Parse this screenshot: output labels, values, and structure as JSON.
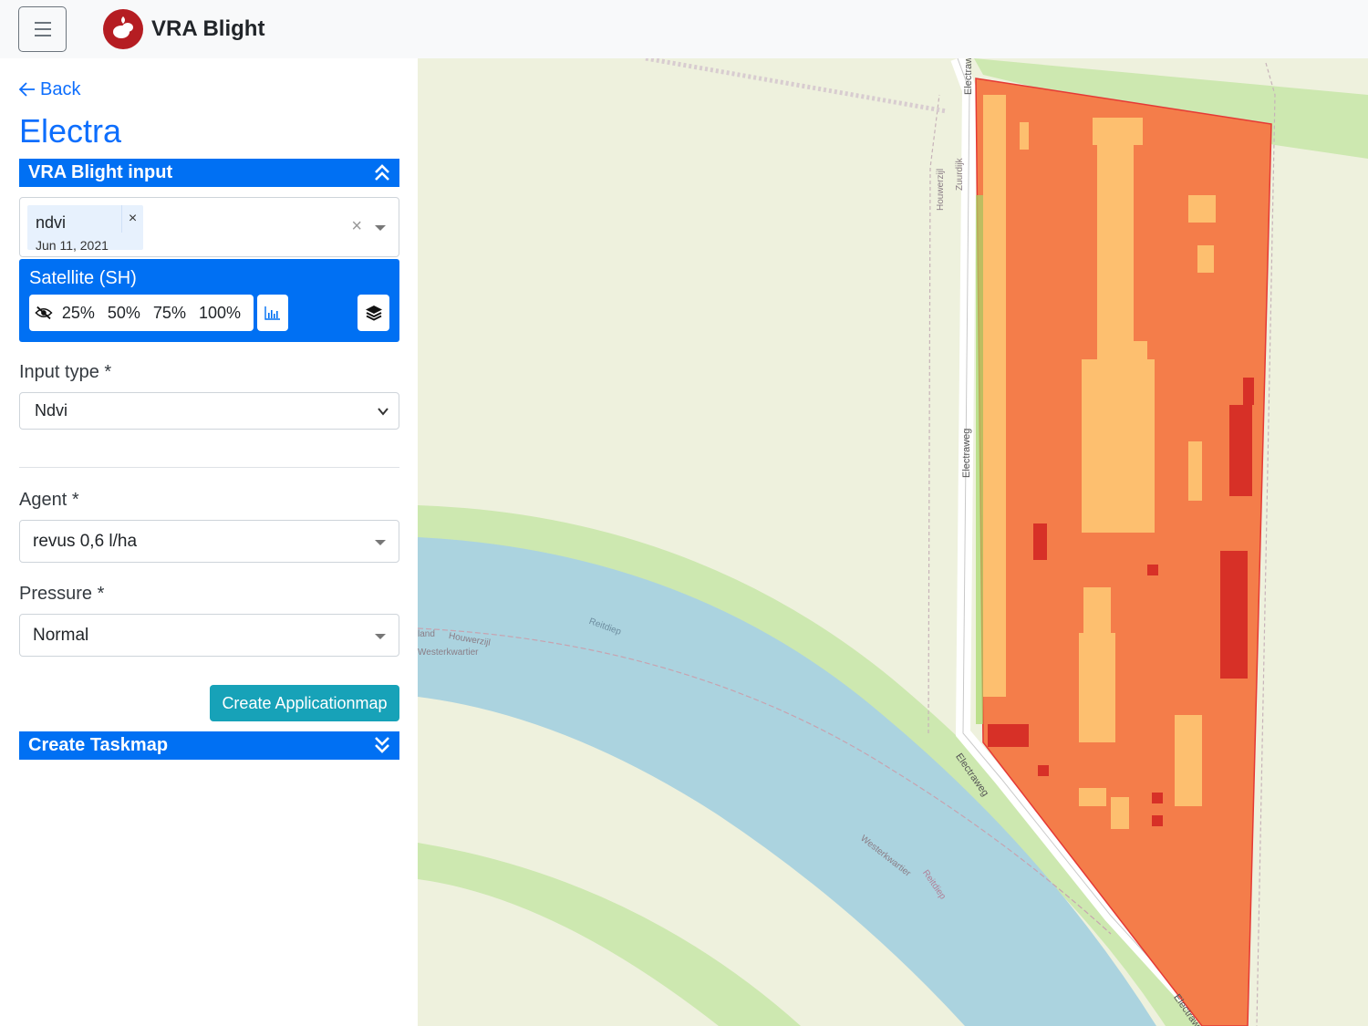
{
  "header": {
    "app_title": "VRA Blight",
    "menu_icon": "hamburger-icon",
    "logo_icon": "potato-logo-icon"
  },
  "sidebar": {
    "back_label": "Back",
    "field_name": "Electra",
    "vra_section": {
      "title": "VRA Blight input",
      "icon": "chevrons-up-icon"
    },
    "input_select": {
      "selected": [
        {
          "name": "ndvi",
          "date": "Jun 11, 2021",
          "remove_label": "×"
        }
      ],
      "clear_label": "×"
    },
    "satellite": {
      "label": "Satellite (SH)",
      "opacity_options": [
        "25%",
        "50%",
        "75%",
        "100%"
      ],
      "hide_icon": "eye-slash-icon",
      "chart_icon": "bar-chart-icon",
      "layers_icon": "layers-icon"
    },
    "input_type": {
      "label": "Input type *",
      "value": "Ndvi"
    },
    "agent": {
      "label": "Agent *",
      "value": "revus 0,6 l/ha"
    },
    "pressure": {
      "label": "Pressure *",
      "value": "Normal"
    },
    "create_applicationmap_label": "Create Applicationmap",
    "taskmap_section": {
      "title": "Create Taskmap",
      "icon": "chevrons-down-icon"
    }
  },
  "map": {
    "labels": {
      "road_1": "Electraweg",
      "road_2": "Electraweg",
      "road_3": "Electraweg",
      "road_4": "Electraweg",
      "dijk_1": "Houwerzijl",
      "dijk_2": "Zuurdijk",
      "water_1": "Reitdiep",
      "water_2": "Reitdiep",
      "area_1": "Houwerzijl",
      "area_2": "Westerkwartier",
      "area_3": "Westerkwartier",
      "area_4": "land"
    },
    "colors": {
      "water": "#abd3df",
      "grass": "#cde8b0",
      "land": "#eef1dd",
      "ndvi_low": "#d73027",
      "ndvi_mid": "#f47d4a",
      "ndvi_high": "#fdbf6f"
    }
  }
}
